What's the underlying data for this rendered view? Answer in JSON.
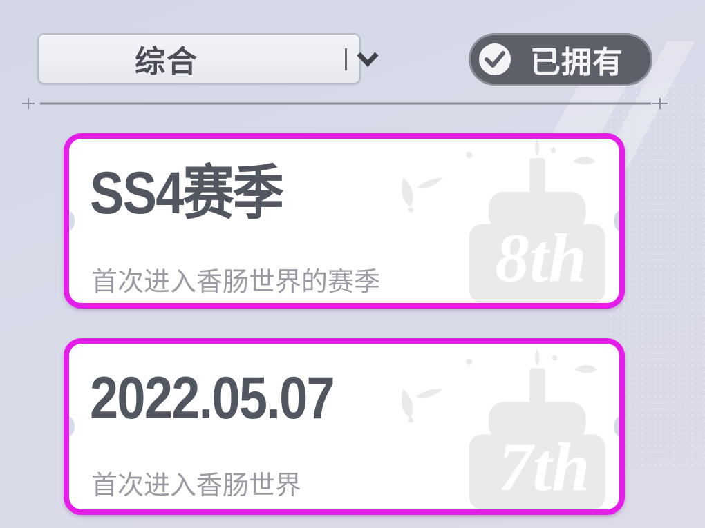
{
  "filter": {
    "sort_label": "综合",
    "owned_label": "已拥有"
  },
  "cards": [
    {
      "title": "SS4赛季",
      "description": "首次进入香肠世界的赛季",
      "badge": "8th"
    },
    {
      "title": "2022.05.07",
      "description": "首次进入香肠世界",
      "badge": "7th"
    }
  ],
  "colors": {
    "card_border": "#e41de9",
    "title_text": "#525660",
    "desc_text": "#9a9ca3",
    "toggle_bg": "#5d6068"
  },
  "icons": {
    "dropdown": "chevron-down-icon",
    "owned": "check-circle-icon",
    "card_art": "birthday-cake-icon"
  }
}
